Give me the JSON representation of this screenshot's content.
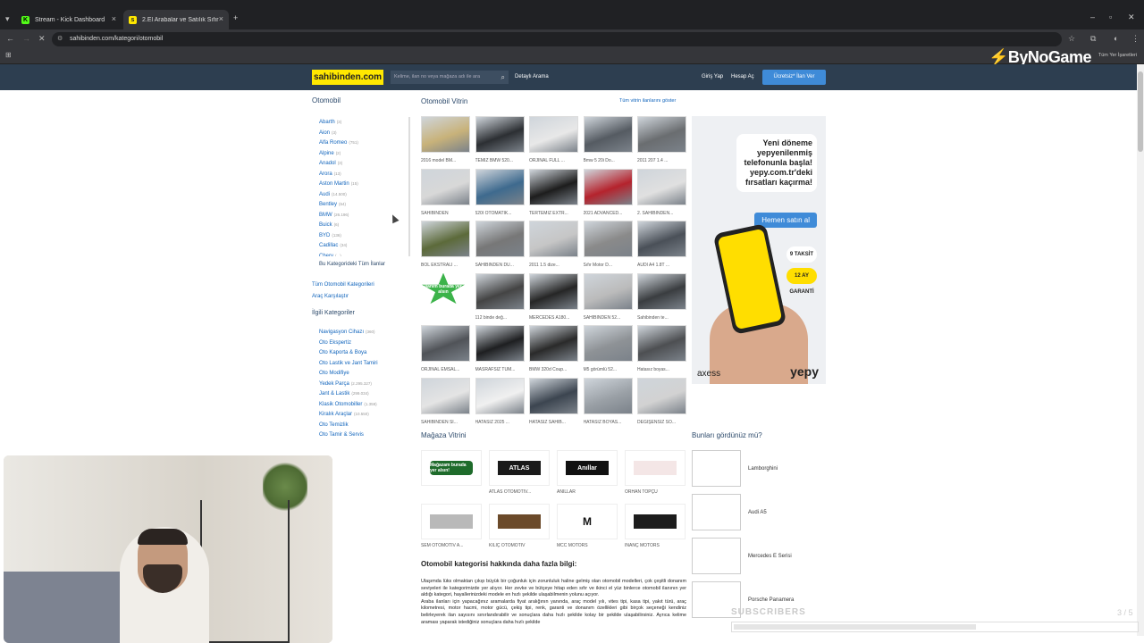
{
  "browser": {
    "tabs": [
      {
        "title": "Stream - Kick Dashboard",
        "icon": "kick-icon"
      },
      {
        "title": "2.El Arabalar ve Satılık Sıfır Km...",
        "icon": "sahibinden-icon"
      }
    ],
    "url": "sahibinden.com/kategori/otomobil",
    "bookmarks_right": "Tüm Yer İşaretleri"
  },
  "overlay": {
    "brand": "ByNoGame",
    "subscribers_label": "SUBSCRIBERS",
    "subscribers_count": "3 / 5",
    "subscribers_progress": 0.6
  },
  "header": {
    "logo": "sahibinden.com",
    "search_placeholder": "Kelime, ilan no veya mağaza adı ile ara",
    "detailed_search": "Detaylı Arama",
    "login": "Giriş Yap",
    "register": "Hesap Aç",
    "post_ad": "Ücretsiz* İlan Ver"
  },
  "sidebar": {
    "title": "Otomobil",
    "categories": [
      {
        "name": "Abarth",
        "count": "(3)"
      },
      {
        "name": "Aion",
        "count": "(3)"
      },
      {
        "name": "Alfa Romeo",
        "count": "(751)"
      },
      {
        "name": "Alpine",
        "count": "(2)"
      },
      {
        "name": "Anadol",
        "count": "(3)"
      },
      {
        "name": "Arora",
        "count": "(13)"
      },
      {
        "name": "Aston Martin",
        "count": "(15)"
      },
      {
        "name": "Audi",
        "count": "(14.500)"
      },
      {
        "name": "Bentley",
        "count": "(64)"
      },
      {
        "name": "BMW",
        "count": "(26.196)"
      },
      {
        "name": "Buick",
        "count": "(6)"
      },
      {
        "name": "BYD",
        "count": "(136)"
      },
      {
        "name": "Cadillac",
        "count": "(34)"
      },
      {
        "name": "Chery",
        "count": "(...)"
      }
    ],
    "all_in_category": "Bu Kategorideki Tüm İlanlar",
    "all_categories": "Tüm Otomobil Kategorileri",
    "compare": "Araç Karşılaştır",
    "related_title": "İlgili Kategoriler",
    "related": [
      {
        "name": "Navigasyon Cihazı",
        "count": "(360)"
      },
      {
        "name": "Oto Ekspertiz",
        "count": ""
      },
      {
        "name": "Oto Kaporta & Boya",
        "count": ""
      },
      {
        "name": "Oto Lastik ve Jant Tamiri",
        "count": ""
      },
      {
        "name": "Oto Modifiye",
        "count": ""
      },
      {
        "name": "Yedek Parça",
        "count": "(2.295.327)"
      },
      {
        "name": "Jant & Lastik",
        "count": "(299.034)"
      },
      {
        "name": "Klasik Otomobiller",
        "count": "(1.359)"
      },
      {
        "name": "Kiralık Araçlar",
        "count": "(10.550)"
      },
      {
        "name": "Oto Temizlik",
        "count": ""
      },
      {
        "name": "Oto Tamir & Servis",
        "count": ""
      }
    ]
  },
  "showcase": {
    "title": "Otomobil Vitrin",
    "show_all": "Tüm vitrin ilanlarını göster",
    "items": [
      "2016 model BM...",
      "TEMİZ BMW 520...",
      "ORJİNAL FULL ...",
      "Bmw 5 20i Do...",
      "2011 207 1.4 ...",
      "SAHİBİNDEN",
      "520İ OTOMATİK...",
      "TERTEMİZ EXTR...",
      "2021 ADVANCED...",
      "2. SAHİBİNDEN...",
      "BOL EKSTRALI ...",
      "SAHİBİNDEN DÜ...",
      "2011 1.5 dize...",
      "Sıfır Motor D...",
      "AUDİ A4 1.8T ...",
      "",
      "112 binde değ...",
      "MERCEDES A180...",
      "SAHİBİNDEN 52...",
      "Sahibinden te...",
      "ORJİNAL EMSAL...",
      "MASRAFSIZ TÜM...",
      "BMW 320d Coup...",
      "M5 görümlü 52...",
      "Hatasız boyas...",
      "SAHİBİNDEN Sİ...",
      "HATASIZ 2025 ...",
      "HATASIZ SAHİB...",
      "HATASIZ BOYAS...",
      "DEĞİŞENSİZ SO..."
    ],
    "promo_star": "İlanım burada yer alsın"
  },
  "ad": {
    "headline": "Yeni döneme yepyenilenmiş telefonunla başla! yepy.com.tr'deki fırsatları kaçırma!",
    "cta": "Hemen satın al",
    "badge1": "9 TAKSİT",
    "badge2": "12 AY GARANTİ",
    "brand_left": "axess",
    "brand_right": "yepy"
  },
  "stores": {
    "title": "Mağaza Vitrini",
    "items": [
      {
        "name": "",
        "logo": "Mağazam burada yer alsın!",
        "color": "#1e6b2b"
      },
      {
        "name": "ATLAS OTOMOTİV...",
        "logo": "ATLAS",
        "color": "#1a1a1a"
      },
      {
        "name": "ANILLAR",
        "logo": "Anıllar",
        "color": "#111111"
      },
      {
        "name": "ORHAN TOPÇU",
        "logo": "",
        "color": "#f4e6e6"
      },
      {
        "name": "SEM OTOMOTİV A...",
        "logo": "",
        "color": "#b9b9b9"
      },
      {
        "name": "KILIÇ OTOMOTİV",
        "logo": "",
        "color": "#6b4a2a"
      },
      {
        "name": "MCC MOTORS",
        "logo": "M",
        "color": "#ffffff"
      },
      {
        "name": "İNANÇ MOTORS",
        "logo": "",
        "color": "#1c1c1c"
      }
    ]
  },
  "seen": {
    "title": "Bunları gördünüz mü?",
    "items": [
      "Lamborghini",
      "Audi A5",
      "Mercedes E Serisi",
      "Porsche Panamera"
    ]
  },
  "about": {
    "title": "Otomobil kategorisi hakkında daha fazla bilgi:",
    "p1": "Ulaşımda lüks olmaktan çıkıp büyük bir çoğunluk için zorunluluk haline gelmiş olan otomobil modelleri, çok çeşitli donanım seviyeleri ile kategorimizde yer alıyor. Her zevke ve bütçeye hitap eden sıfır ve ikinci el yüz binlerce otomobil ilanının yer aldığı kategori, hayallerinizdeki modele en hızlı şekilde ulaşabilmenin yolunu açıyor.",
    "p2": "Araba ilanları için yapacağınız aramalarda fiyat aralığının yanında, araç model yılı, vites tipi, kasa tipi, yakıt türü, araç kilometresi, motor hacmi, motor gücü, çekiş tipi, renk, garanti ve donanım özellikleri gibi birçok seçeneği kendiniz belirleyerek ilan sayısını sınırlandırabilir ve sonuçlara daha hızlı şekilde kolay bir şekilde ulaşabilirsiniz. Ayrıca kelime araması yaparak istediğiniz sonuçlara daha hızlı şekilde"
  }
}
